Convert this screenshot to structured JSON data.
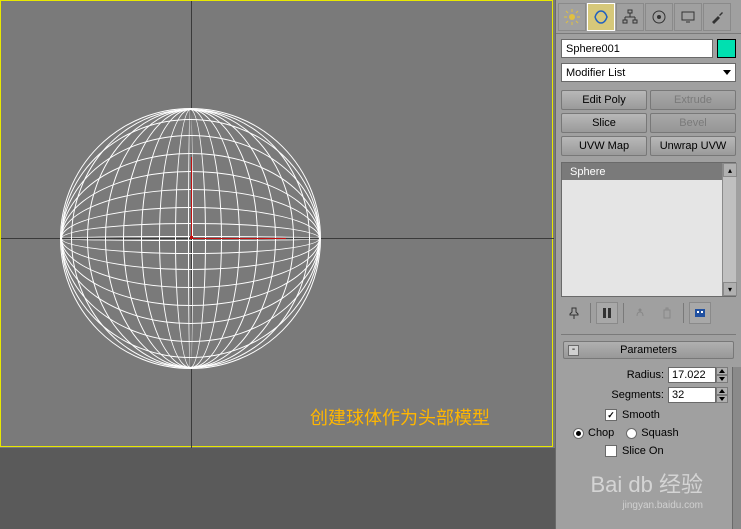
{
  "object_name": "Sphere001",
  "object_color": "#00e0b0",
  "modifier_combo": "Modifier List",
  "modifier_buttons": {
    "edit_poly": "Edit Poly",
    "extrude": "Extrude",
    "slice": "Slice",
    "bevel": "Bevel",
    "uvw_map": "UVW Map",
    "unwrap_uvw": "Unwrap UVW"
  },
  "stack_item": "Sphere",
  "rollout_title": "Parameters",
  "params": {
    "radius_label": "Radius:",
    "radius_value": "17.022",
    "segments_label": "Segments:",
    "segments_value": "32",
    "smooth_label": "Smooth",
    "chop_label": "Chop",
    "squash_label": "Squash",
    "slice_on_label": "Slice On"
  },
  "annotation": "创建球体作为头部模型",
  "watermark": "Bai db 经验",
  "watermark_sub": "jingyan.baidu.com"
}
